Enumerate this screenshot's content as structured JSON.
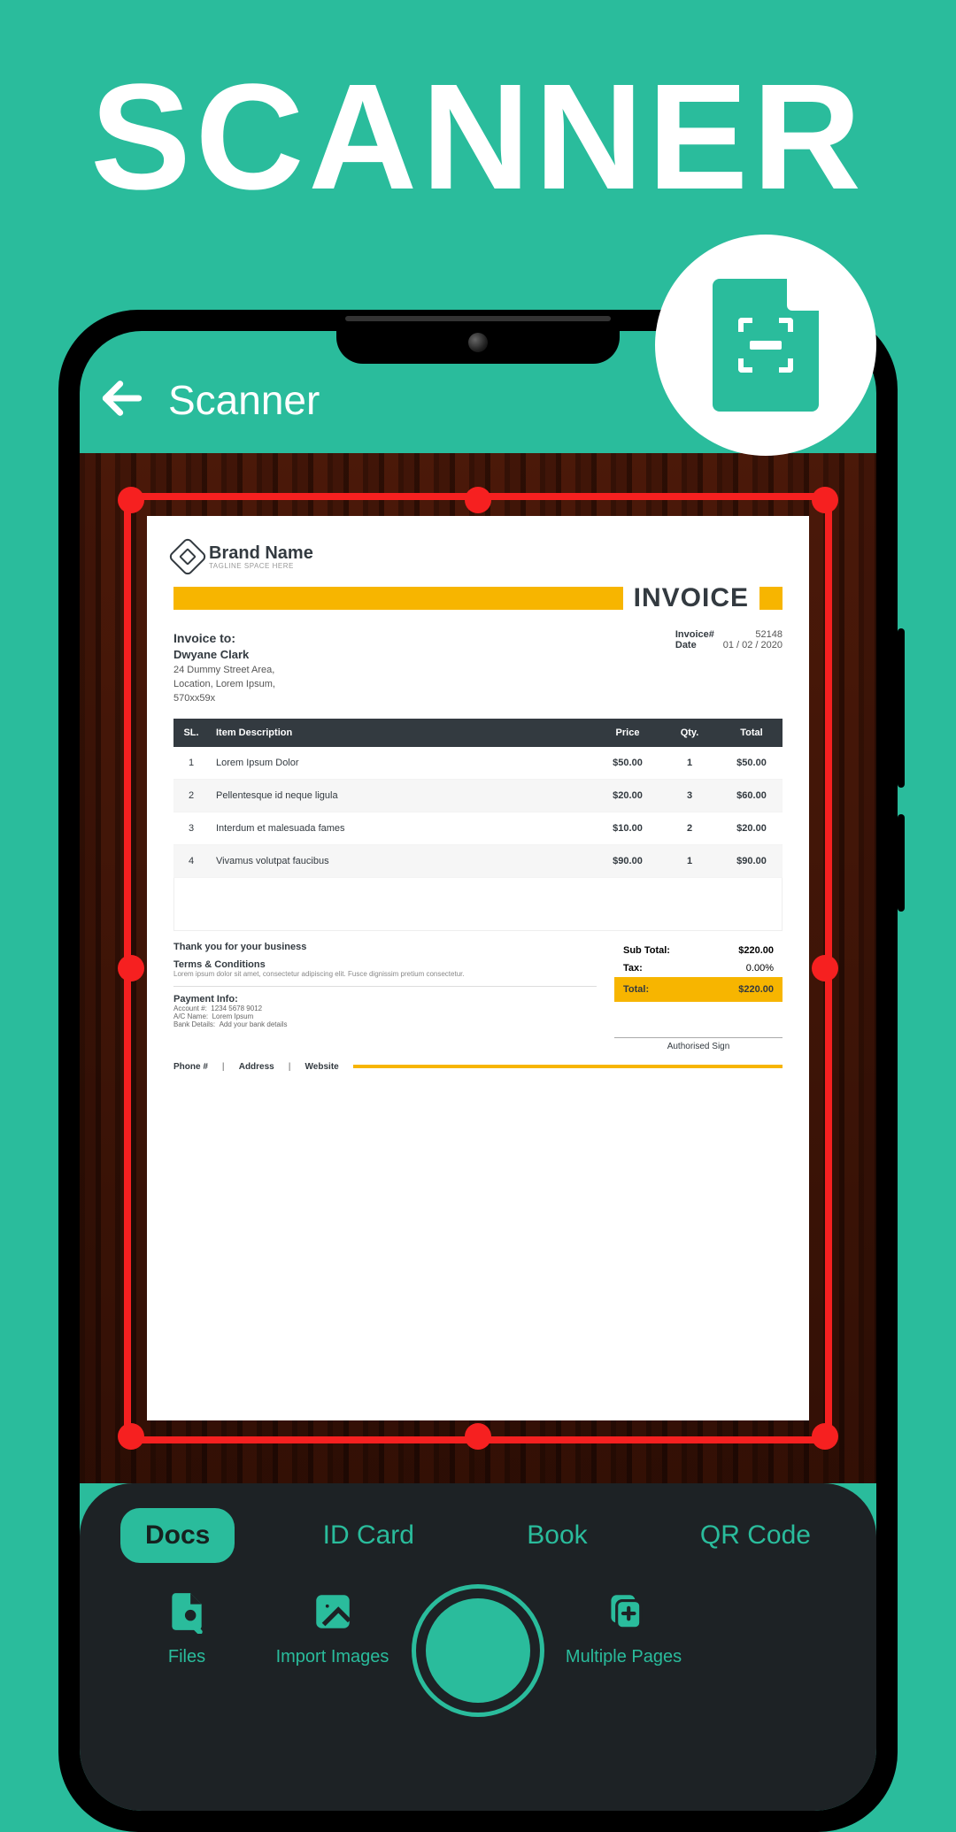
{
  "promo": {
    "title": "SCANNER"
  },
  "appbar": {
    "title": "Scanner"
  },
  "modes": {
    "docs": "Docs",
    "idcard": "ID Card",
    "book": "Book",
    "qrcode": "QR Code"
  },
  "tools": {
    "files": "Files",
    "import": "Import Images",
    "multipage": "Multiple Pages"
  },
  "document": {
    "brand": {
      "name": "Brand Name",
      "tagline": "TAGLINE SPACE HERE"
    },
    "title": "INVOICE",
    "invoice_to_label": "Invoice to:",
    "client_name": "Dwyane Clark",
    "address_l1": "24 Dummy Street Area,",
    "address_l2": "Location, Lorem Ipsum,",
    "address_l3": "570xx59x",
    "invoice_no_label": "Invoice#",
    "invoice_no": "52148",
    "date_label": "Date",
    "date": "01 / 02 / 2020",
    "cols": {
      "sl": "SL.",
      "desc": "Item Description",
      "price": "Price",
      "qty": "Qty.",
      "total": "Total"
    },
    "rows": [
      {
        "sl": "1",
        "desc": "Lorem Ipsum Dolor",
        "price": "$50.00",
        "qty": "1",
        "total": "$50.00"
      },
      {
        "sl": "2",
        "desc": "Pellentesque id neque ligula",
        "price": "$20.00",
        "qty": "3",
        "total": "$60.00"
      },
      {
        "sl": "3",
        "desc": "Interdum et malesuada fames",
        "price": "$10.00",
        "qty": "2",
        "total": "$20.00"
      },
      {
        "sl": "4",
        "desc": "Vivamus volutpat faucibus",
        "price": "$90.00",
        "qty": "1",
        "total": "$90.00"
      }
    ],
    "thank": "Thank you for your business",
    "tc_label": "Terms & Conditions",
    "tc_text": "Lorem ipsum dolor sit amet, consectetur adipiscing elit. Fusce dignissim pretium consectetur.",
    "pi_label": "Payment Info:",
    "pi_acc_l": "Account #:",
    "pi_acc_v": "1234 5678 9012",
    "pi_name_l": "A/C Name:",
    "pi_name_v": "Lorem Ipsum",
    "pi_bank_l": "Bank Details:",
    "pi_bank_v": "Add your bank details",
    "subtotal_l": "Sub Total:",
    "subtotal_v": "$220.00",
    "tax_l": "Tax:",
    "tax_v": "0.00%",
    "total_l": "Total:",
    "total_v": "$220.00",
    "sign": "Authorised Sign",
    "footer_phone": "Phone #",
    "footer_addr": "Address",
    "footer_web": "Website"
  }
}
